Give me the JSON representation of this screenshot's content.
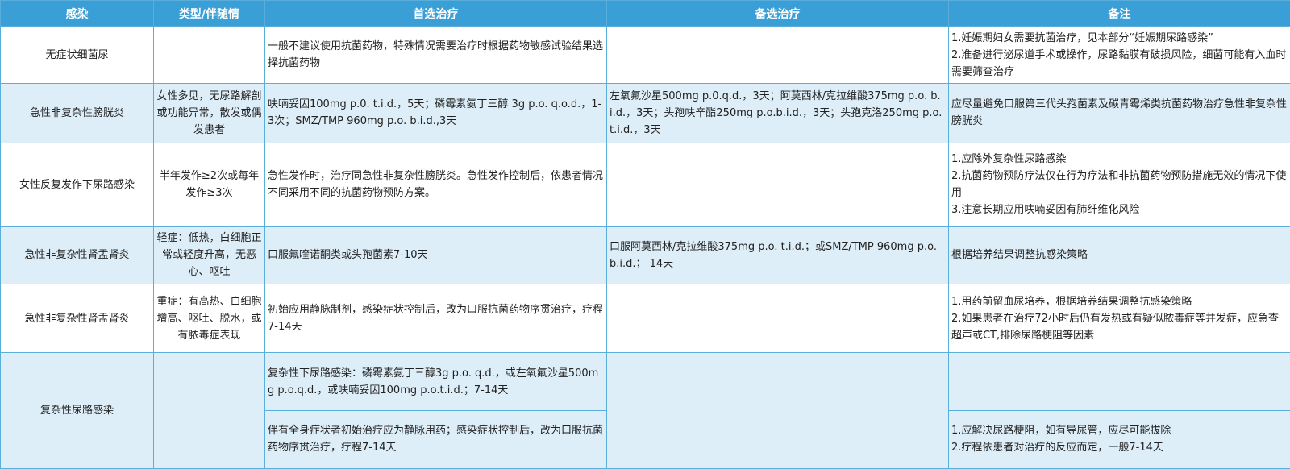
{
  "headers": [
    "感染",
    "类型/伴随情",
    "首选治疗",
    "备选治疗",
    "备注"
  ],
  "rows": [
    {
      "infection": "无症状细菌尿",
      "type": "",
      "preferred": "一般不建议使用抗菌药物，特殊情况需要治疗时根据药物敏感试验结果选择抗菌药物",
      "alternative": "",
      "notes": [
        "1.妊娠期妇女需要抗菌治疗，见本部分“妊娠期尿路感染”",
        "2.准备进行泌尿道手术或操作，尿路黏膜有破损风险，细菌可能有入血时需要筛查治疗"
      ]
    },
    {
      "infection": "急性非复杂性膀胱炎",
      "type": "女性多见，无尿路解剖或功能异常，散发或偶发患者",
      "preferred": "呋喃妥因100mg p.0. t.i.d.，5天；磷霉素氨丁三醇 3g p.o. q.o.d.，1-3次；SMZ/TMP 960mg p.o. b.i.d.,3天",
      "alternative": "左氧氟沙星500mg p.0.q.d.，3天；阿莫西林/克拉维酸375mg p.o. b.i.d.，3天；头孢呋辛酯250mg p.o.b.i.d.，3天；头孢克洛250mg p.o.t.i.d.，3天",
      "notes": [
        "应尽量避免口服第三代头孢菌素及碳青霉烯类抗菌药物治疗急性非复杂性膀胱炎"
      ]
    },
    {
      "infection": "女性反复发作下尿路感染",
      "type": "半年发作≥2次或每年发作≥3次",
      "preferred": "急性发作时，治疗同急性非复杂性膀胱炎。急性发作控制后，依患者情况不同采用不同的抗菌药物预防方案。",
      "alternative": "",
      "notes": [
        "1.应除外复杂性尿路感染",
        "2.抗菌药物预防疗法仅在行为疗法和非抗菌药物预防措施无效的情况下使用",
        "3.注意长期应用呋喃妥因有肺纤维化风险"
      ]
    },
    {
      "infection": "急性非复杂性肾盂肾炎",
      "type": "轻症：低热，白细胞正常或轻度升高，无恶心、呕吐",
      "preferred": "口服氟喹诺酮类或头孢菌素7-10天",
      "alternative": "口服阿莫西林/克拉维酸375mg p.o. t.i.d.；或SMZ/TMP 960mg p.o.b.i.d.； 14天",
      "notes": [
        "根据培养结果调整抗感染策略"
      ]
    },
    {
      "infection": "急性非复杂性肾盂肾炎",
      "type": "重症：有高热、白细胞增高、呕吐、脱水，或有脓毒症表现",
      "preferred": "初始应用静脉制剂，感染症状控制后，改为口服抗菌药物序贯治疗，疗程7-14天",
      "alternative": "",
      "notes": [
        "1.用药前留血尿培养，根据培养结果调整抗感染策略",
        "2.如果患者在治疗72小时后仍有发热或有疑似脓毒症等并发症，应急查超声或CT,排除尿路梗阻等因素"
      ]
    }
  ],
  "complex": {
    "infection": "复杂性尿路感染",
    "type": "",
    "preferred_1": "复杂性下尿路感染：磷霉素氨丁三醇3g p.o. q.d.，或左氧氟沙星500mg p.o.q.d.，或呋喃妥因100mg p.o.t.i.d.；7-14天",
    "preferred_2": "伴有全身症状者初始治疗应为静脉用药；感染症状控制后，改为口服抗菌药物序贯治疗，疗程7-14天",
    "alternative": "",
    "notes_1": [],
    "notes_2": [
      "1.应解决尿路梗阻，如有导尿管，应尽可能拔除",
      "2.疗程依患者对治疗的反应而定，一般7-14天"
    ]
  }
}
